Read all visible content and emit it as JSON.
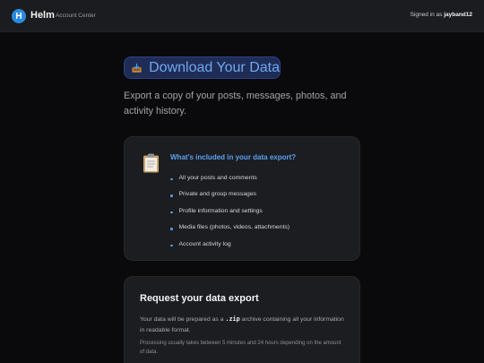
{
  "header": {
    "logo_letter": "H",
    "brand_name": "Helm",
    "brand_sub": "Account Center",
    "signed_in_prefix": "Signed in as",
    "username": "jayband12"
  },
  "hero": {
    "title_icon": "inbox-tray-icon",
    "title": "Download Your Data",
    "subtitle": "Export a copy of your posts, messages, photos, and activity history."
  },
  "included": {
    "icon": "clipboard-icon",
    "heading": "What’s included in your data export?",
    "items": [
      "All your posts and comments",
      "Private and group messages",
      "Profile information and settings",
      "Media files (photos, videos, attachments)",
      "Account activity log"
    ]
  },
  "request": {
    "heading": "Request your data export",
    "desc_before": "Your data will be prepared as a",
    "desc_code": ".zip",
    "desc_after": "archive containing all your information in readable format.",
    "note": "Processing usually takes between 5 minutes and 24 hours depending on the amount of data."
  },
  "colors": {
    "accent": "#5aa0f0",
    "title_pill": "#1f2c56",
    "logo": "#2a8be0"
  }
}
